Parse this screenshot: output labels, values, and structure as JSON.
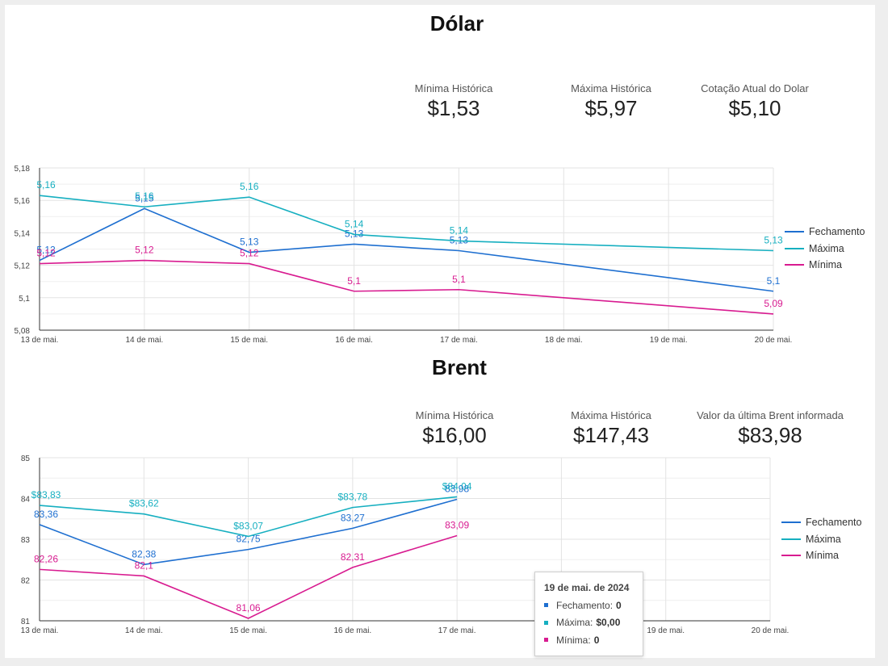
{
  "colors": {
    "fechamento": "#1e6fd0",
    "maxima": "#16afc0",
    "minima": "#d81b90"
  },
  "dolar": {
    "title": "Dólar",
    "kpis": [
      {
        "label": "Mínima Histórica",
        "value": "$1,53"
      },
      {
        "label": "Máxima Histórica",
        "value": "$5,97"
      },
      {
        "label": "Cotação Atual do Dolar",
        "value": "$5,10"
      }
    ]
  },
  "brent": {
    "title": "Brent",
    "kpis": [
      {
        "label": "Mínima Histórica",
        "value": "$16,00"
      },
      {
        "label": "Máxima Histórica",
        "value": "$147,43"
      },
      {
        "label": "Valor da última Brent informada",
        "value": "$83,98"
      }
    ]
  },
  "chart_data": [
    {
      "type": "line",
      "ylim": [
        5.08,
        5.18
      ],
      "y_ticks": [
        "5,18",
        "5,16",
        "5,14",
        "5,12",
        "5,1",
        "5,08"
      ],
      "categories": [
        "13 de mai.",
        "14 de mai.",
        "15 de mai.",
        "16 de mai.",
        "17 de mai.",
        "18 de mai.",
        "19 de mai.",
        "20 de mai."
      ],
      "legend": "right",
      "series": [
        {
          "name": "Fechamento",
          "color": "#1e6fd0",
          "values": [
            5.123,
            5.155,
            5.128,
            5.133,
            5.129,
            null,
            null,
            5.104
          ],
          "labels": [
            "5,12",
            "5,15",
            "5,13",
            "5,13",
            "5,13",
            null,
            null,
            "5,1"
          ]
        },
        {
          "name": "Máxima",
          "color": "#16afc0",
          "values": [
            5.163,
            5.156,
            5.162,
            5.139,
            5.135,
            null,
            null,
            5.129
          ],
          "labels": [
            "5,16",
            "5,16",
            "5,16",
            "5,14",
            "5,14",
            null,
            null,
            "5,13"
          ]
        },
        {
          "name": "Mínima",
          "color": "#d81b90",
          "values": [
            5.121,
            5.123,
            5.121,
            5.104,
            5.105,
            null,
            null,
            5.09
          ],
          "labels": [
            "5,12",
            "5,12",
            "5,12",
            "5,1",
            "5,1",
            null,
            null,
            "5,09"
          ]
        }
      ]
    },
    {
      "type": "line",
      "ylim": [
        81,
        85
      ],
      "y_ticks": [
        "85",
        "84",
        "83",
        "82",
        "81"
      ],
      "categories": [
        "13 de mai.",
        "14 de mai.",
        "15 de mai.",
        "16 de mai.",
        "17 de mai.",
        "18 de mai.",
        "19 de mai.",
        "20 de mai."
      ],
      "legend": "right",
      "series": [
        {
          "name": "Fechamento",
          "color": "#1e6fd0",
          "values": [
            83.36,
            82.38,
            82.75,
            83.27,
            83.98,
            null,
            null,
            null
          ],
          "labels": [
            "83,36",
            "82,38",
            "82,75",
            "83,27",
            "83,98",
            null,
            null,
            null
          ]
        },
        {
          "name": "Máxima",
          "color": "#16afc0",
          "values": [
            83.83,
            83.62,
            83.07,
            83.78,
            84.04,
            null,
            null,
            null
          ],
          "labels": [
            "$83,83",
            "$83,62",
            "$83,07",
            "$83,78",
            "$84,04",
            null,
            null,
            null
          ]
        },
        {
          "name": "Mínima",
          "color": "#d81b90",
          "values": [
            82.26,
            82.1,
            81.06,
            82.31,
            83.09,
            null,
            null,
            null
          ],
          "labels": [
            "82,26",
            "82,1",
            "81,06",
            "82,31",
            "83,09",
            null,
            null,
            null
          ]
        }
      ]
    }
  ],
  "tooltip": {
    "title": "19 de mai. de 2024",
    "rows": [
      {
        "label": "Fechamento:",
        "value": "0"
      },
      {
        "label": "Máxima:",
        "value": "$0,00"
      },
      {
        "label": "Mínima:",
        "value": "0"
      }
    ]
  }
}
